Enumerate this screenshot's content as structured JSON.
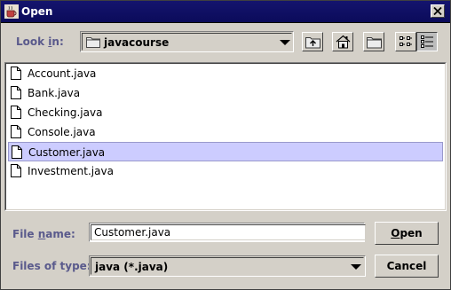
{
  "window": {
    "title": "Open",
    "icon": "coffee-cup-icon"
  },
  "look_in": {
    "label_before": "Look ",
    "label_mnemonic": "i",
    "label_after": "n:",
    "value": "javacourse"
  },
  "toolbar": {
    "up_icon": "up-folder-icon",
    "home_icon": "home-icon",
    "new_folder_icon": "new-folder-icon",
    "list_view_icon": "list-view-icon",
    "details_view_icon": "details-view-icon"
  },
  "files": [
    {
      "name": "Account.java"
    },
    {
      "name": "Bank.java"
    },
    {
      "name": "Checking.java"
    },
    {
      "name": "Console.java"
    },
    {
      "name": "Customer.java"
    },
    {
      "name": "Investment.java"
    }
  ],
  "selected_file_index": 4,
  "file_name": {
    "label_before": "File ",
    "label_mnemonic": "n",
    "label_after": "ame:",
    "value": "Customer.java"
  },
  "files_of_type": {
    "label": "Files of type:",
    "value": "java (*.java)"
  },
  "buttons": {
    "open_mnemonic": "O",
    "open_rest": "pen",
    "cancel_label": "Cancel"
  },
  "colors": {
    "title_bar": "#0b0b5a",
    "label_text": "#5a5a8c",
    "selection": "#ccccff"
  }
}
